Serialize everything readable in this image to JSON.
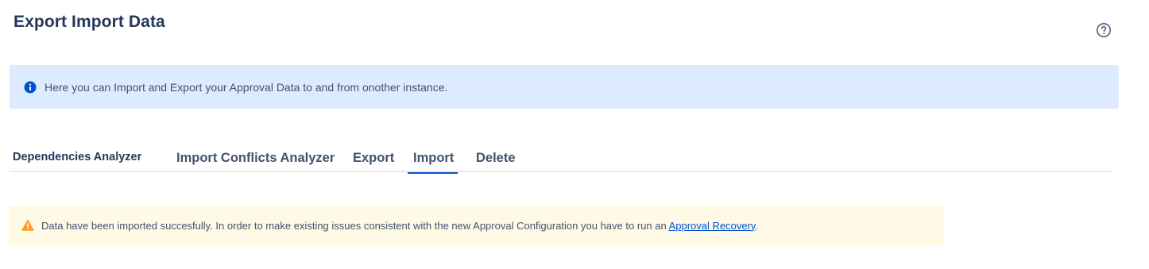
{
  "page": {
    "title": "Export Import Data",
    "help_icon": "question-circle-icon"
  },
  "info_banner": {
    "icon": "info-icon",
    "text": "Here you can Import and Export your Approval Data to and from onother instance."
  },
  "tabs": [
    {
      "label": "Dependencies Analyzer",
      "active": false
    },
    {
      "label": "Import Conflicts Analyzer",
      "active": false
    },
    {
      "label": "Export",
      "active": false
    },
    {
      "label": "Import",
      "active": true
    },
    {
      "label": "Delete",
      "active": false
    }
  ],
  "warning_banner": {
    "icon": "warning-icon",
    "text_before": "Data have been imported succesfully. In order to make existing issues consistent with the new Approval Configuration you have to run an ",
    "link_text": "Approval Recovery",
    "text_after": "."
  },
  "colors": {
    "info_background": "#deebff",
    "info_icon": "#0052cc",
    "warning_background": "#fffae6",
    "warning_icon": "#ff991f",
    "active_tab_underline": "#0052cc",
    "link": "#0052cc"
  }
}
